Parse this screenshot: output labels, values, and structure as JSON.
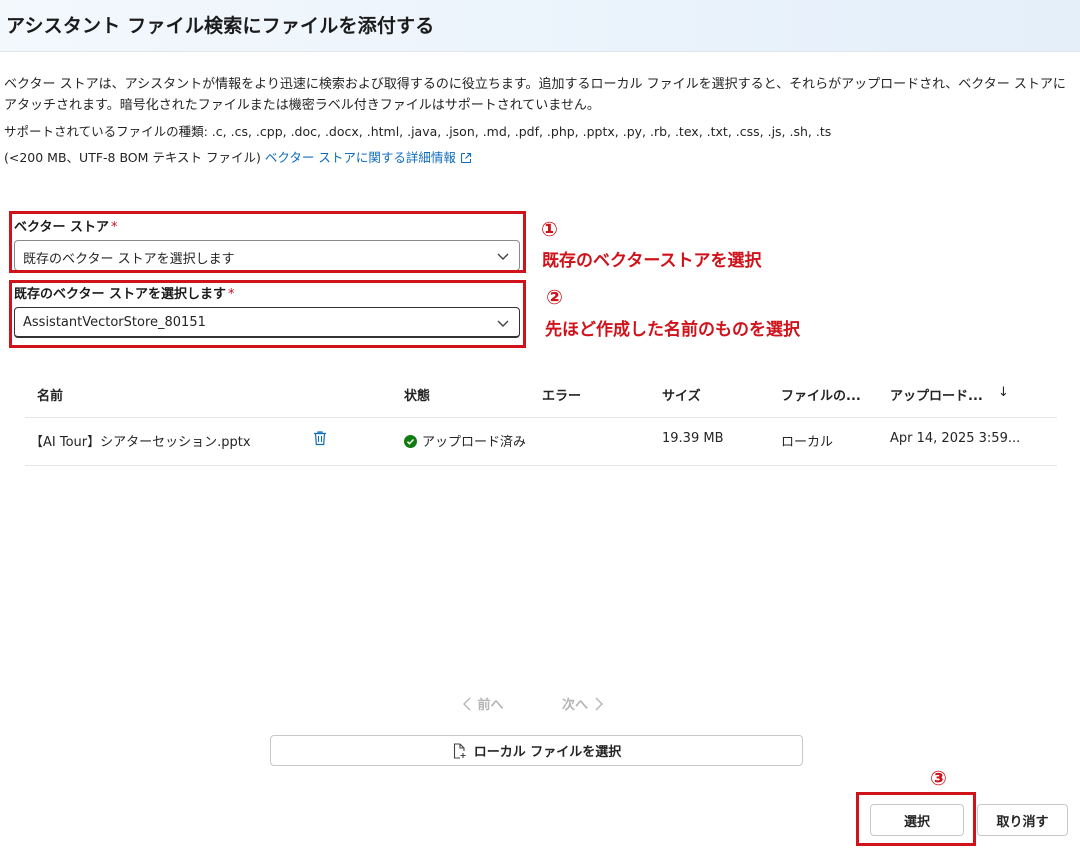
{
  "header": {
    "title": "アシスタント ファイル検索にファイルを添付する"
  },
  "description": {
    "text": "ベクター ストアは、アシスタントが情報をより迅速に検索および取得するのに役立ちます。追加するローカル ファイルを選択すると、それらがアップロードされ、ベクター ストアにアタッチされます。暗号化されたファイルまたは機密ラベル付きファイルはサポートされていません。",
    "supported_types": "サポートされているファイルの種類: .c, .cs, .cpp, .doc, .docx, .html, .java, .json, .md, .pdf, .php, .pptx, .py, .rb, .tex, .txt, .css, .js, .sh, .ts",
    "size_limit": "(<200 MB、UTF-8 BOM テキスト ファイル)",
    "learn_more_link": "ベクター ストアに関する詳細情報"
  },
  "vector_store_field": {
    "label": "ベクター ストア",
    "required_mark": "*",
    "value": "既存のベクター ストアを選択します"
  },
  "existing_store_field": {
    "label": "既存のベクター ストアを選択します",
    "required_mark": "*",
    "value": "AssistantVectorStore_80151"
  },
  "annotations": {
    "one": {
      "number": "①",
      "text": "既存のベクターストアを選択"
    },
    "two": {
      "number": "②",
      "text": "先ほど作成した名前のものを選択"
    },
    "three": {
      "number": "③"
    }
  },
  "table": {
    "columns": [
      "名前",
      "状態",
      "エラー",
      "サイズ",
      "ファイルの...",
      "アップロード...",
      "↓"
    ],
    "rows": [
      {
        "name": "【AI Tour】シアターセッション.pptx",
        "status": "アップロード済み",
        "error": "",
        "size": "19.39 MB",
        "source": "ローカル",
        "uploaded": "Apr 14, 2025 3:59..."
      }
    ]
  },
  "pager": {
    "prev": "前へ",
    "next": "次へ"
  },
  "buttons": {
    "select_local": "ローカル ファイルを選択",
    "select": "選択",
    "cancel": "取り消す"
  },
  "colors": {
    "annotation_red": "#d0121b",
    "link_blue": "#0f6cbd",
    "success_green": "#107c10",
    "required_red": "#c50f1f"
  }
}
